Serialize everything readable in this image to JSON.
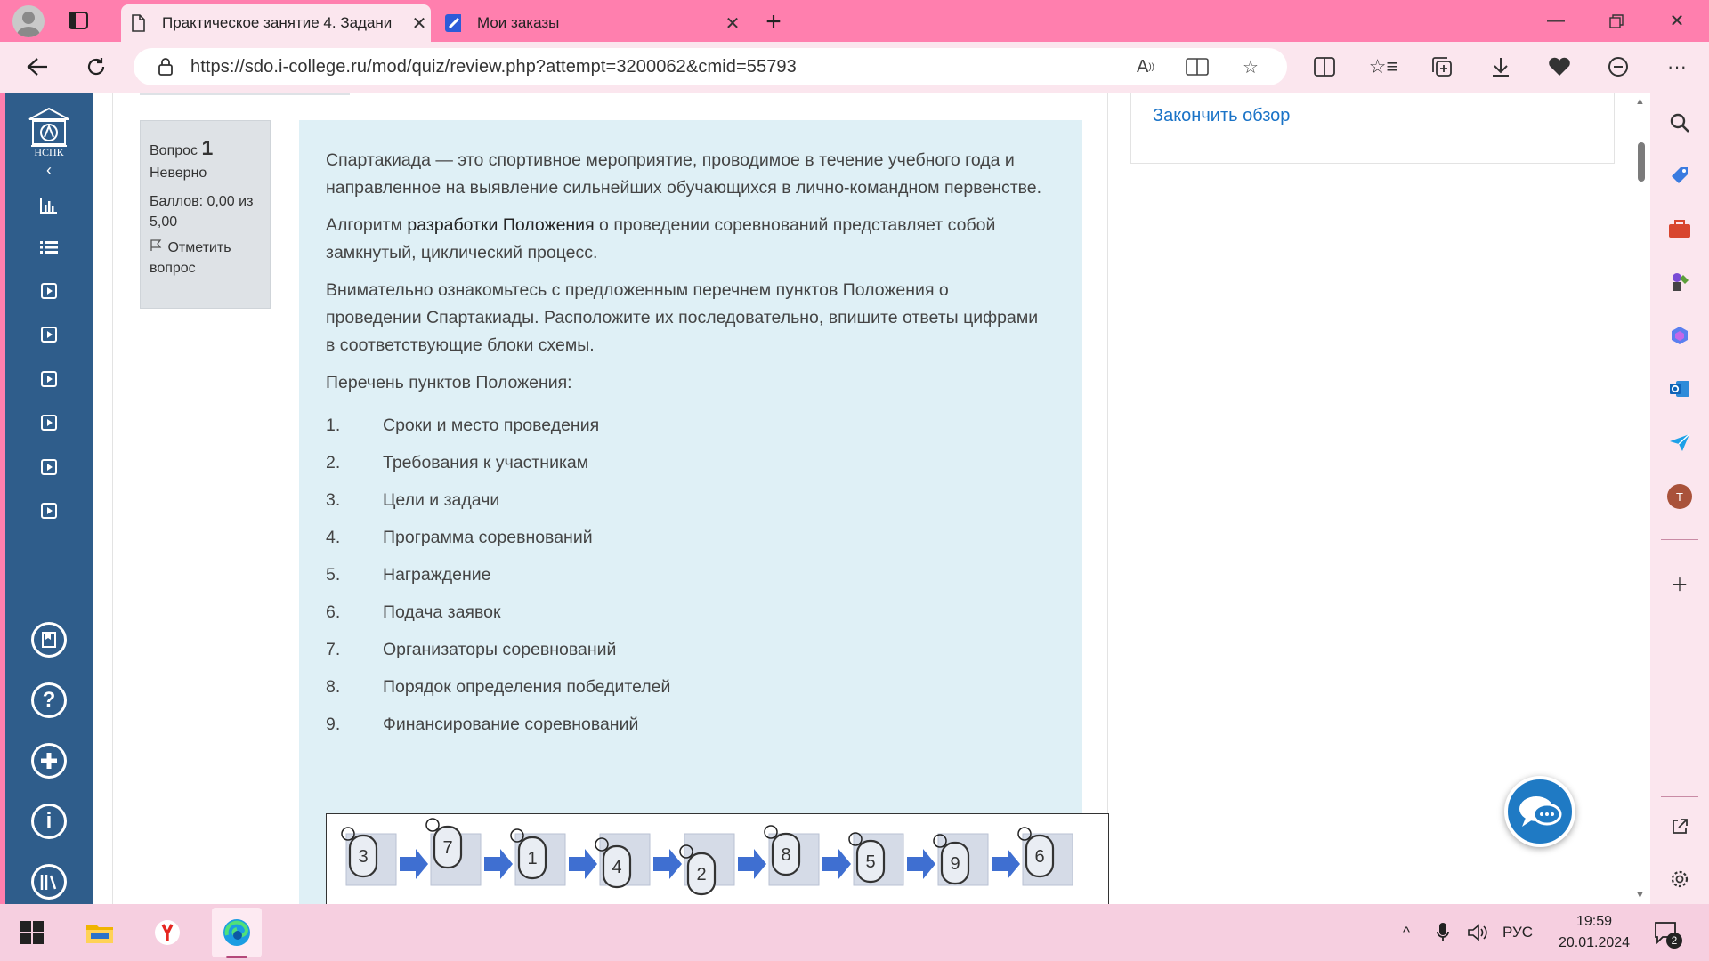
{
  "browser": {
    "tabs": [
      {
        "title": "Практическое занятие 4. Задани",
        "active": true
      },
      {
        "title": "Мои заказы",
        "active": false
      }
    ],
    "url": "https://sdo.i-college.ru/mod/quiz/review.php?attempt=3200062&cmid=55793"
  },
  "drawer": {
    "logo_text": "НСПК",
    "collapse_icon": "chevron-left-icon"
  },
  "question_info": {
    "label": "Вопрос",
    "number": "1",
    "status": "Неверно",
    "score": "Баллов: 0,00 из 5,00",
    "flag_label": "Отметить вопрос"
  },
  "question": {
    "p1": "Спартакиада — это спортивное мероприятие, проводимое в течение учебного года и направленное на выявление сильнейших обучающихся в лично-командном первенстве.",
    "p2_a": "Алгоритм ",
    "p2_b": "разработки Положения",
    "p2_c": " о проведении соревнований представляет собой замкнутый, циклический процесс.",
    "p3": "Внимательно ознакомьтесь с предложенным перечнем пунктов Положения о проведении Спартакиады. Расположите их последовательно, впишите ответы цифрами в соответствующие блоки схемы.",
    "p4": "Перечень пунктов Положения:",
    "items": [
      {
        "num": "1.",
        "text": "Сроки и место проведения"
      },
      {
        "num": "2.",
        "text": "Требования к участникам"
      },
      {
        "num": "3.",
        "text": "Цели и задачи"
      },
      {
        "num": "4.",
        "text": "Программа соревнований"
      },
      {
        "num": "5.",
        "text": "Награждение"
      },
      {
        "num": "6.",
        "text": "Подача заявок"
      },
      {
        "num": "7.",
        "text": "Организаторы соревнований"
      },
      {
        "num": "8.",
        "text": "Порядок определения победителей"
      },
      {
        "num": "9.",
        "text": "Финансирование соревнований"
      }
    ],
    "scheme_answers": [
      "3",
      "7",
      "1",
      "4",
      "2",
      "8",
      "5",
      "9",
      "6"
    ]
  },
  "right_block": {
    "finish_review": "Закончить обзор"
  },
  "taskbar": {
    "lang": "РУС",
    "time": "19:59",
    "date": "20.01.2024",
    "notifications": "2"
  },
  "colors": {
    "frame_pink": "#ff7fae",
    "drawer_blue": "#2f5d8b",
    "question_bg": "#dff0f6",
    "link_blue": "#1a73c7"
  }
}
